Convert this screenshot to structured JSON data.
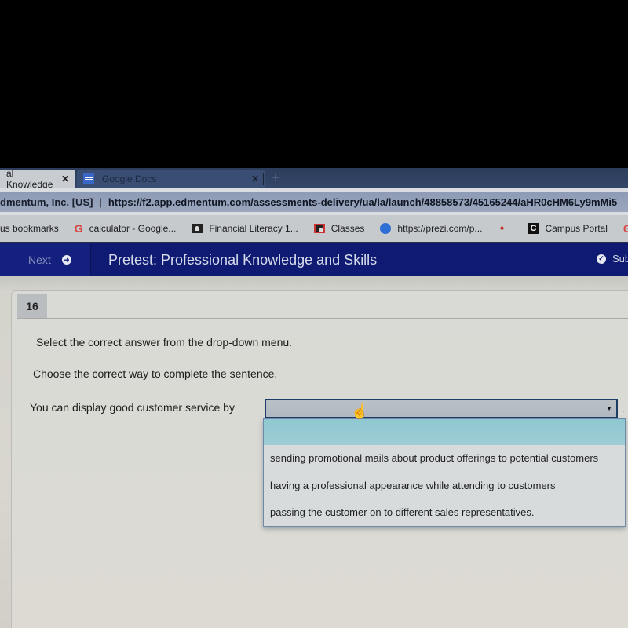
{
  "browser": {
    "tabs": [
      {
        "label": "al Knowledge",
        "active": true,
        "close": "✕"
      },
      {
        "label": "Google Docs",
        "active": false,
        "close": "✕",
        "icon": "google-docs-icon"
      }
    ],
    "new_tab": "+",
    "address": {
      "org": "dmentum, Inc. [US]",
      "separator": "|",
      "url": "https://f2.app.edmentum.com/assessments-delivery/ua/la/launch/48858573/45165244/aHR0cHM6Ly9mMi5"
    },
    "bookmarks": [
      {
        "label": "us bookmarks",
        "icon": null
      },
      {
        "label": "calculator - Google...",
        "icon": "google-icon"
      },
      {
        "label": "Financial Literacy 1...",
        "icon": "classroom-icon"
      },
      {
        "label": "Classes",
        "icon": "classroom-icon"
      },
      {
        "label": "https://prezi.com/p...",
        "icon": "prezi-icon"
      },
      {
        "label": "",
        "icon": "pin-icon"
      },
      {
        "label": "Campus Portal",
        "icon": "campus-portal-icon"
      },
      {
        "label": "G",
        "icon": "google-icon"
      }
    ]
  },
  "app": {
    "next_label": "Next",
    "title": "Pretest: Professional Knowledge and Skills",
    "submit_label": "Sub"
  },
  "question": {
    "number": "16",
    "instruction": "Select the correct answer from the drop-down menu.",
    "prompt": "Choose the correct way to complete the sentence.",
    "sentence_start": "You can display good customer service by",
    "sentence_end": ".",
    "dropdown": {
      "selected": "",
      "options": [
        "",
        "sending promotional mails about product offerings to potential customers",
        "having a professional appearance while attending to customers",
        "passing the customer on to different sales representatives."
      ]
    }
  }
}
